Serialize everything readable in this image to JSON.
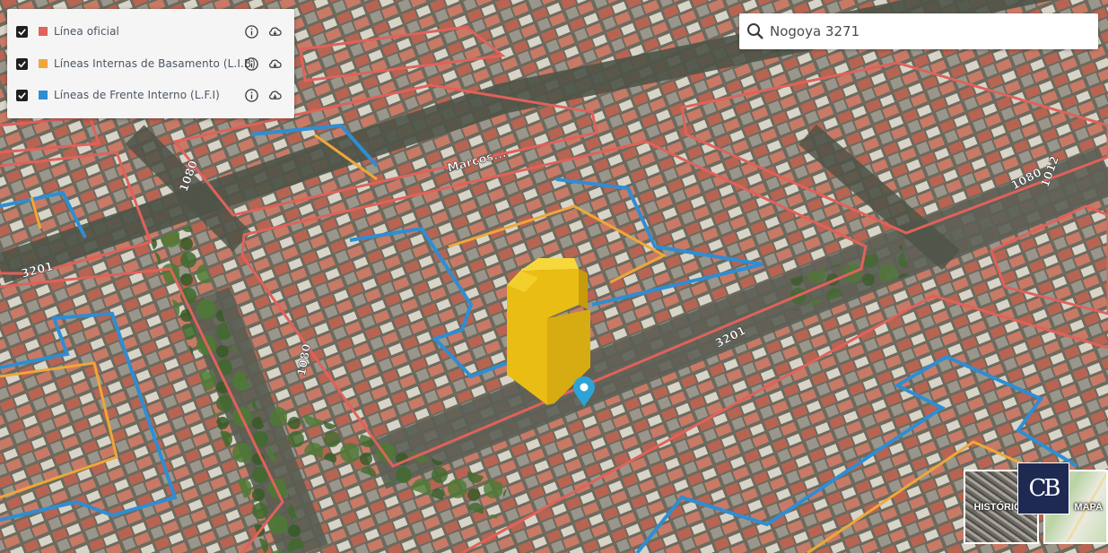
{
  "layers_panel": {
    "items": [
      {
        "label": "Línea oficial",
        "color": "#e0625a",
        "checked": true
      },
      {
        "label": "Líneas Internas de Basamento (L.I.B)",
        "color": "#f0a63a",
        "checked": true
      },
      {
        "label": "Líneas de Frente Interno (L.F.I)",
        "color": "#2f8dd3",
        "checked": true
      }
    ]
  },
  "search": {
    "value": "Nogoya 3271"
  },
  "map_labels": {
    "street_1": "3201",
    "street_2": "1080",
    "street_3": "3201",
    "street_4": "1080",
    "street_5": "1080",
    "street_6": "Marcos...",
    "street_7": "1012"
  },
  "colors": {
    "official_line": "#e0625a",
    "lib_line": "#f0a63a",
    "lfi_line": "#2f8dd3",
    "building": "#f2c81a",
    "pin": "#2ea3d6"
  },
  "map_controls": {
    "historic_label": "HISTÓRICO",
    "map_label": "MAPA",
    "logo_text": "CB"
  }
}
